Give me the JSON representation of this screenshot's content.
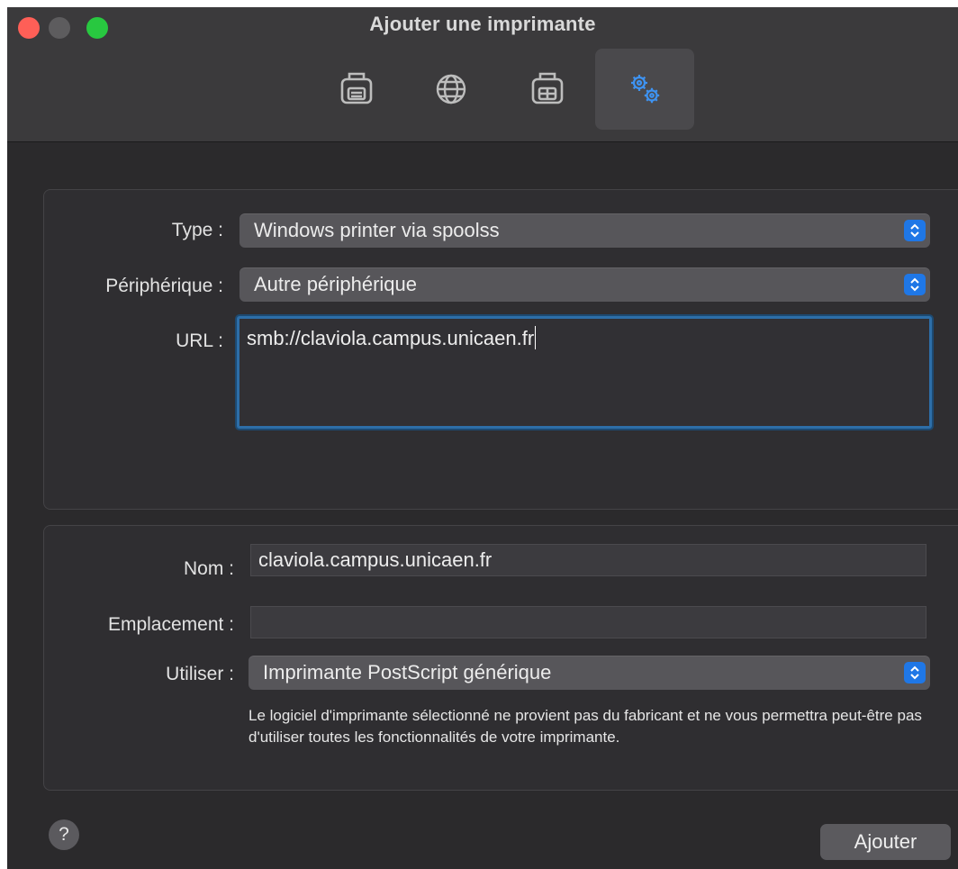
{
  "window": {
    "title": "Ajouter une imprimante"
  },
  "toolbar": {
    "buttons": [
      {
        "icon": "printer-icon",
        "active": false
      },
      {
        "icon": "globe-icon",
        "active": false
      },
      {
        "icon": "windows-printer-icon",
        "active": false
      },
      {
        "icon": "advanced-gears-icon",
        "active": true
      }
    ]
  },
  "form": {
    "type_label": "Type :",
    "type_value": "Windows printer via spoolss",
    "device_label": "Périphérique :",
    "device_value": "Autre périphérique",
    "url_label": "URL :",
    "url_value": "smb://claviola.campus.unicaen.fr",
    "name_label": "Nom :",
    "name_value": "claviola.campus.unicaen.fr",
    "location_label": "Emplacement :",
    "location_value": "",
    "use_label": "Utiliser :",
    "use_value": "Imprimante PostScript générique",
    "note": "Le logiciel d'imprimante sélectionné ne provient pas du fabricant et ne vous permettra peut-être pas d'utiliser toutes les fonctionnalités de votre imprimante."
  },
  "footer": {
    "help": "?",
    "add_label": "Ajouter"
  },
  "colors": {
    "accent": "#1f77e6",
    "focus_ring": "#2d6ea8",
    "background": "#2b2a2c"
  }
}
